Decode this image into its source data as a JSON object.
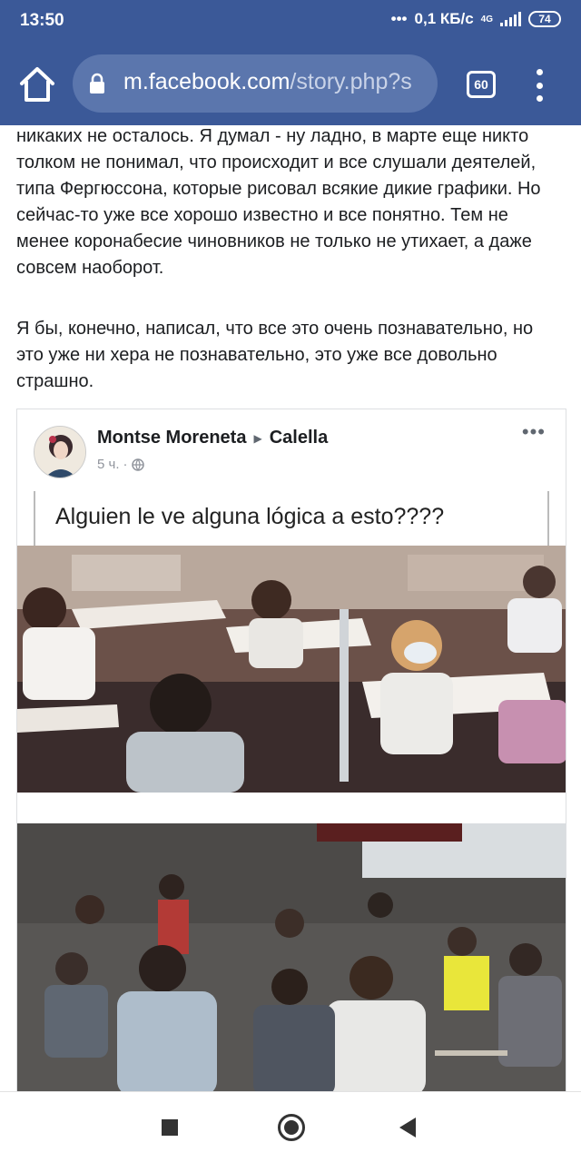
{
  "status_bar": {
    "time": "13:50",
    "speed": "0,1 КБ/с",
    "network": "4G",
    "battery": "74"
  },
  "browser": {
    "url_host": "m.facebook.com",
    "url_path": "/story.php?s",
    "tab_count": "60"
  },
  "article": {
    "paragraph_1": "никаких не осталось. Я думал - ну ладно, в марте еще никто толком не понимал, что происходит и все слушали деятелей, типа Фергюссона, которые рисовал всякие дикие графики. Но сейчас-то уже все хорошо известно и все понятно. Тем не менее коронабесие чиновников не только не утихает, а даже совсем наоборот.",
    "paragraph_2": "Я бы, конечно, написал, что все это очень познавательно, но это уже ни хера не познавательно, это уже все довольно страшно."
  },
  "embedded_post": {
    "author": "Montse Moreneta",
    "place": "Calella",
    "time": "5 ч.",
    "caption": "Alguien le ve alguna lógica a esto????",
    "photo_1": "children-in-masks-at-school-desks",
    "photo_2": "adults-without-masks-at-cafe-terrace"
  },
  "colors": {
    "facebook_blue": "#3b5998",
    "omnibox": "#5b76ad"
  }
}
